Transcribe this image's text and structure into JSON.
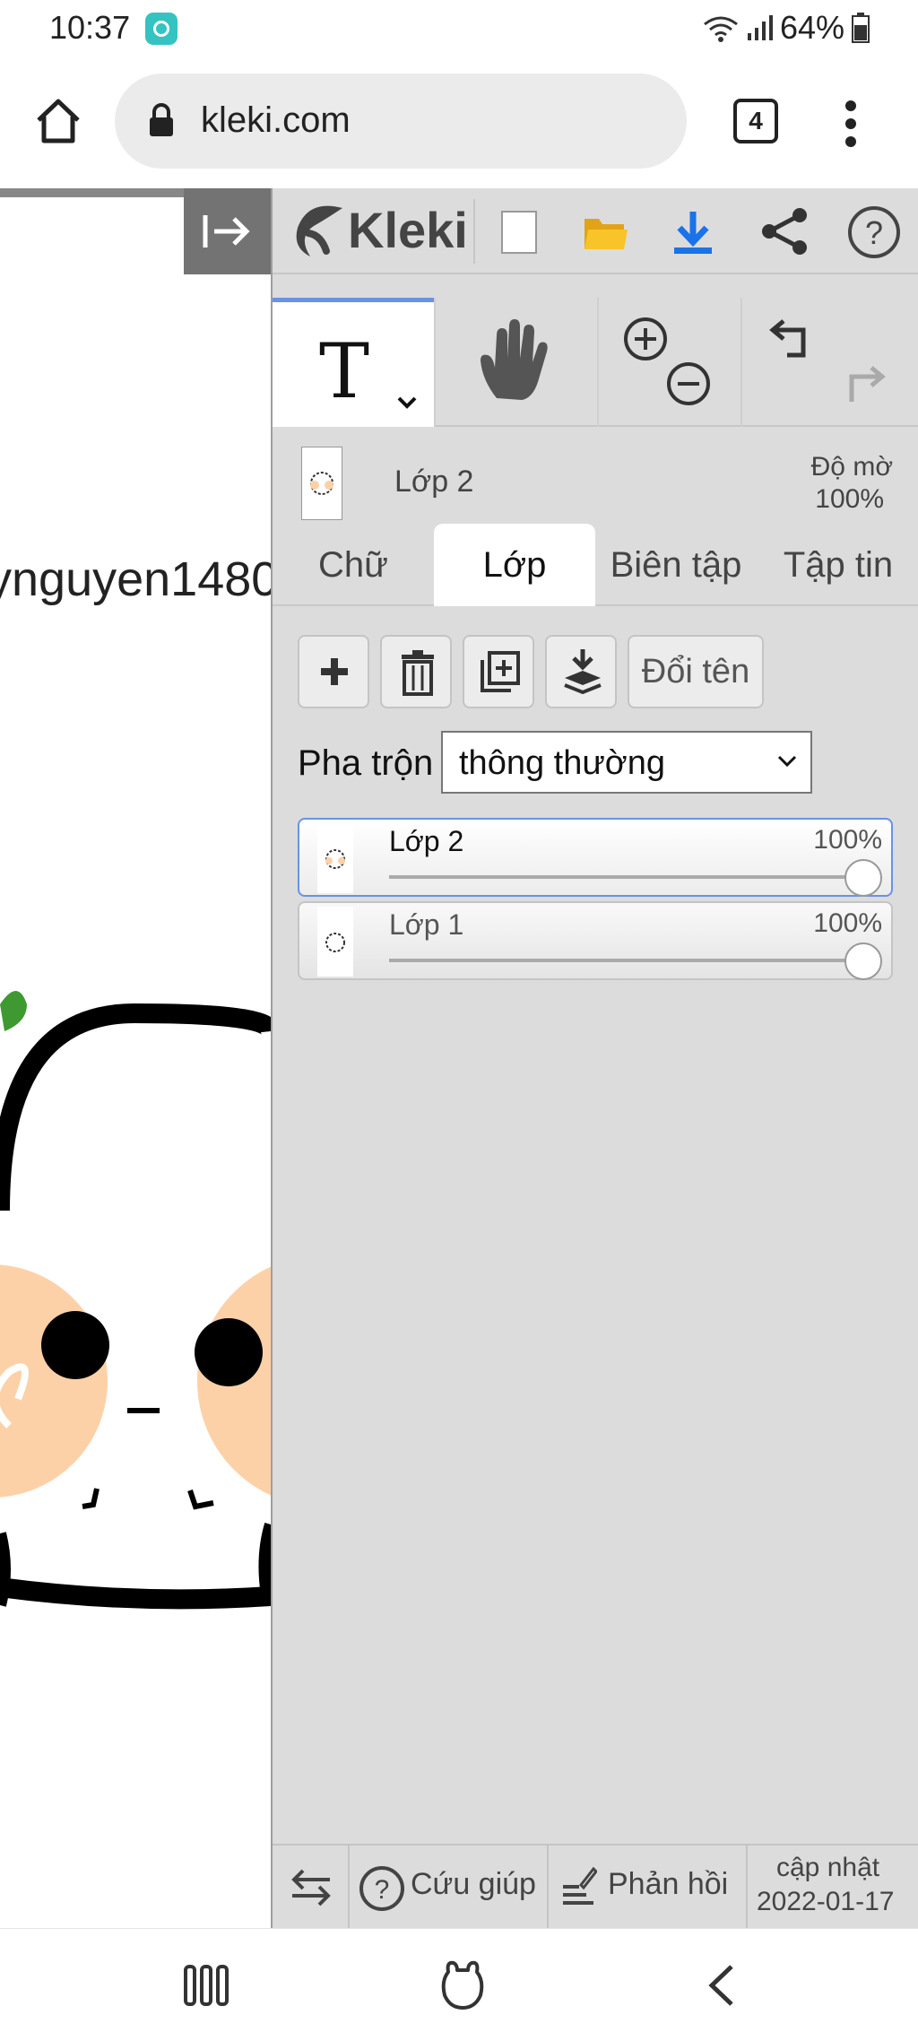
{
  "status_bar": {
    "time": "10:37",
    "battery": "64%"
  },
  "browser": {
    "url": "kleki.com",
    "tab_count": "4"
  },
  "canvas": {
    "username_fragment": "ynguyen1480"
  },
  "app": {
    "name": "Kleki"
  },
  "layer_header": {
    "name": "Lớp 2",
    "opacity_label": "Độ mờ",
    "opacity_value": "100%"
  },
  "tabs": [
    "Chữ",
    "Lớp",
    "Biên tập",
    "Tập tin"
  ],
  "layer_actions": {
    "rename_label": "Đổi tên"
  },
  "blend": {
    "label": "Pha trộn",
    "value": "thông thường"
  },
  "layers": [
    {
      "name": "Lớp 2",
      "opacity": "100%",
      "opacity_fraction": 1.0,
      "selected": true
    },
    {
      "name": "Lớp 1",
      "opacity": "100%",
      "opacity_fraction": 1.0,
      "selected": false
    }
  ],
  "footer": {
    "help": "Cứu giúp",
    "feedback": "Phản hồi",
    "update_label": "cập nhật",
    "update_date": "2022-01-17"
  },
  "colors": {
    "accent": "#6a92e6",
    "download": "#1a73e8",
    "folder": "#f5b820",
    "panel_bg": "#dcdcdc"
  }
}
